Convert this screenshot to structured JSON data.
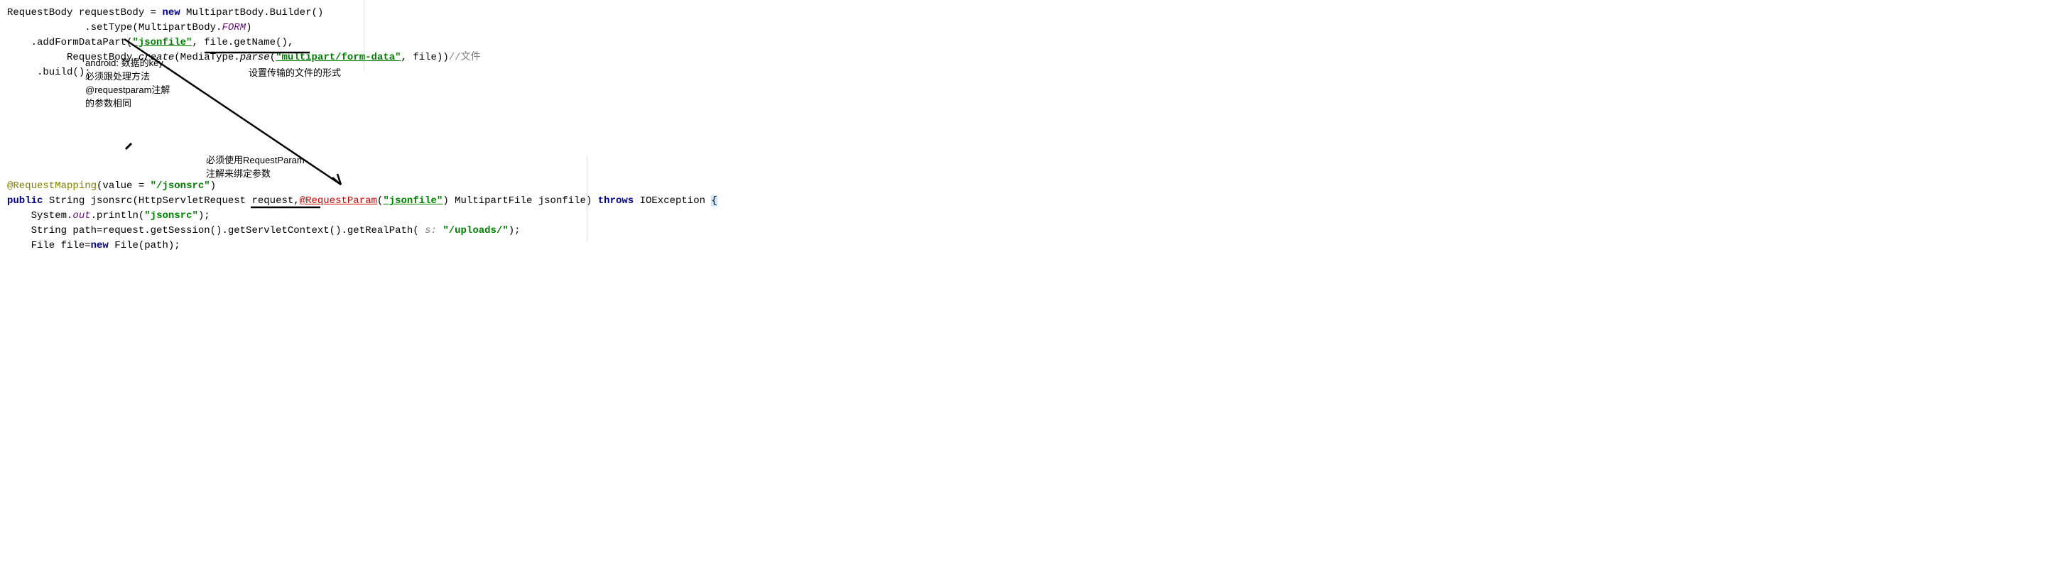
{
  "top_code": {
    "line1": {
      "part1": "RequestBody requestBody = ",
      "keyword": "new",
      "part2": " MultipartBody.Builder()"
    },
    "line2": {
      "part1": "             .setType(MultipartBody.",
      "form": "FORM",
      "part2": ")"
    },
    "line3": {
      "part1": "    .addFormDataPart(",
      "str1": "\"jsonfile\"",
      "part2": ", file.getName(),"
    },
    "line4": {
      "part1": "          RequestBody.",
      "create": "create",
      "part2": "(MediaType.",
      "parse": "parse",
      "part3": "(",
      "str": "\"multipart/form-data\"",
      "part4": ", file))",
      "comment": "//文件"
    },
    "line5": "     .build();"
  },
  "notes": {
    "note1_line1": "android: 数据的key",
    "note1_line2": "必须跟处理方法",
    "note1_line3": "@requestparam注解",
    "note1_line4": "的参数相同",
    "note2": "设置传输的文件的形式",
    "note3_line1": "必须使用RequestParam",
    "note3_line2": "注解来绑定参数"
  },
  "bottom_code": {
    "line1": {
      "annotation": "@RequestMapping",
      "part1": "(value = ",
      "str": "\"/jsonsrc\"",
      "part2": ")"
    },
    "line2": {
      "keyword1": "public",
      "part1": " String jsonsrc(HttpServletRequest request,",
      "reqparam": "@RequestParam",
      "part2": "(",
      "str": "\"jsonfile\"",
      "part3": ") MultipartFile jsonfile) ",
      "keyword2": "throws",
      "part4": " IOException ",
      "bracket": "{"
    },
    "line3": {
      "part1": "    System.",
      "out": "out",
      "part2": ".println(",
      "str": "\"jsonsrc\"",
      "part3": ");"
    },
    "line4": {
      "part1": "    String path=request.getSession().getServletContext().getRealPath( ",
      "hint": "s:",
      "part2": " ",
      "str": "\"/uploads/\"",
      "part3": ");"
    },
    "line5": {
      "part1": "    File file=",
      "keyword": "new",
      "part2": " File(path);"
    }
  }
}
